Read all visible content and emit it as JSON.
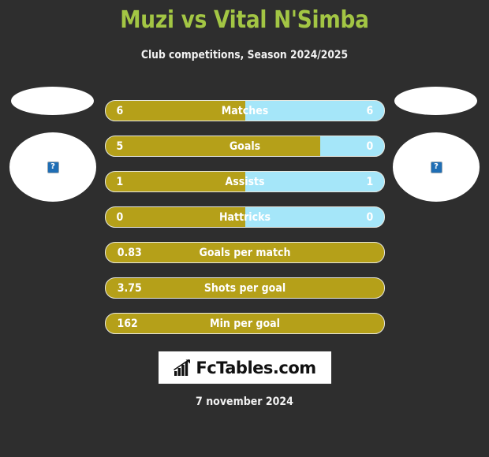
{
  "header": {
    "title": "Muzi vs Vital N'Simba",
    "subtitle": "Club competitions, Season 2024/2025",
    "title_color": "#a3c644",
    "background_color": "#2e2e2e"
  },
  "players": {
    "home": {
      "photo_status": "broken-image",
      "photo_alt": "?"
    },
    "away": {
      "photo_status": "broken-image",
      "photo_alt": "?"
    }
  },
  "colors": {
    "home_bar": "#b5a019",
    "away_bar": "#a5e6f9",
    "bar_border": "#e8e8e0",
    "text": "#ffffff"
  },
  "chart_data": {
    "type": "bar",
    "title": "Muzi vs Vital N'Simba",
    "subtitle": "Club competitions, Season 2024/2025",
    "orientation": "horizontal-diverging",
    "legend": [
      "Muzi",
      "Vital N'Simba"
    ],
    "categories": [
      "Matches",
      "Goals",
      "Assists",
      "Hattricks",
      "Goals per match",
      "Shots per goal",
      "Min per goal"
    ],
    "series": [
      {
        "name": "Muzi",
        "values": [
          6,
          5,
          1,
          0,
          0.83,
          3.75,
          162
        ]
      },
      {
        "name": "Vital N'Simba",
        "values": [
          6,
          0,
          1,
          0,
          null,
          null,
          null
        ]
      }
    ]
  },
  "stats": [
    {
      "label": "Matches",
      "home": "6",
      "away": "6",
      "home_pct": 50,
      "two_sided": true
    },
    {
      "label": "Goals",
      "home": "5",
      "away": "0",
      "home_pct": 77,
      "two_sided": true
    },
    {
      "label": "Assists",
      "home": "1",
      "away": "1",
      "home_pct": 50,
      "two_sided": true
    },
    {
      "label": "Hattricks",
      "home": "0",
      "away": "0",
      "home_pct": 50,
      "two_sided": true
    },
    {
      "label": "Goals per match",
      "home": "0.83",
      "away": "",
      "home_pct": 100,
      "two_sided": false
    },
    {
      "label": "Shots per goal",
      "home": "3.75",
      "away": "",
      "home_pct": 100,
      "two_sided": false
    },
    {
      "label": "Min per goal",
      "home": "162",
      "away": "",
      "home_pct": 100,
      "two_sided": false
    }
  ],
  "footer": {
    "logo_text": "FcTables.com",
    "logo_icon": "bar-chart-icon",
    "date": "7 november 2024"
  }
}
